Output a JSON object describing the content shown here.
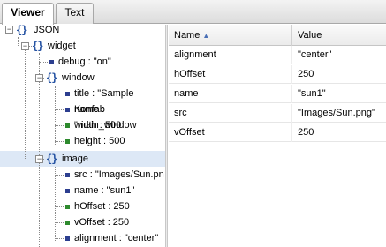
{
  "tabs": [
    {
      "label": "Viewer",
      "active": true
    },
    {
      "label": "Text",
      "active": false
    }
  ],
  "tree": {
    "root": "JSON",
    "widget": "widget",
    "debug": "debug : \"on\"",
    "window": "window",
    "window_title": "title : \"Sample Konfab",
    "window_name": "name : \"main_window",
    "window_width": "width : 500",
    "window_height": "height : 500",
    "image": "image",
    "image_src": "src : \"Images/Sun.pn",
    "image_name": "name : \"sun1\"",
    "image_hoffset": "hOffset : 250",
    "image_voffset": "vOffset : 250",
    "image_alignment": "alignment : \"center\"",
    "object_glyph": "{}"
  },
  "grid": {
    "headers": {
      "name": "Name",
      "value": "Value"
    },
    "sort_glyph": "▲",
    "rows": [
      {
        "name": "alignment",
        "value": "\"center\""
      },
      {
        "name": "hOffset",
        "value": "250"
      },
      {
        "name": "name",
        "value": "\"sun1\""
      },
      {
        "name": "src",
        "value": "\"Images/Sun.png\""
      },
      {
        "name": "vOffset",
        "value": "250"
      }
    ]
  },
  "colors": {
    "selection": "#dde8f6",
    "string_marker": "#2c3e8f",
    "number_marker": "#2d8a2d",
    "object_brace": "#2653a3"
  }
}
